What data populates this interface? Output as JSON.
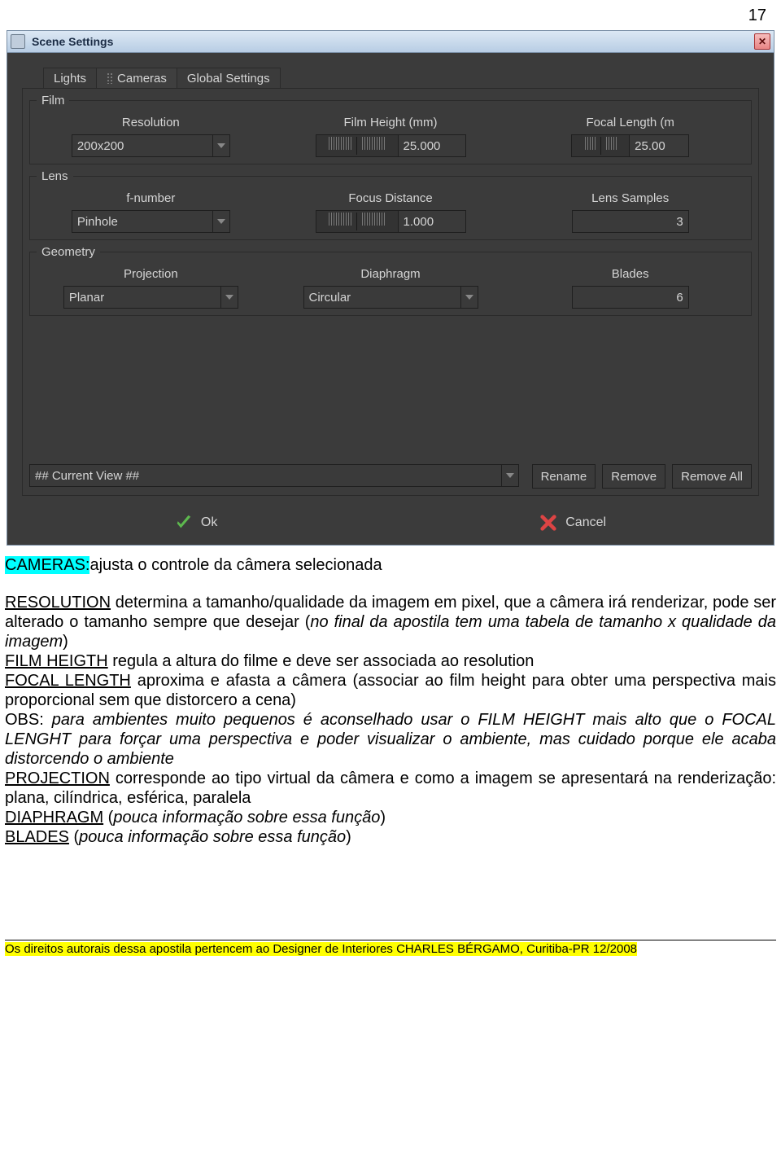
{
  "page_number": "17",
  "window": {
    "title": "Scene Settings"
  },
  "tabs": {
    "t0": "Lights",
    "t1": "Cameras",
    "t2": "Global Settings"
  },
  "film": {
    "legend": "Film",
    "resolution_label": "Resolution",
    "resolution_value": "200x200",
    "height_label": "Film Height (mm)",
    "height_value": "25.000",
    "focal_label": "Focal Length (m",
    "focal_value": "25.00"
  },
  "lens": {
    "legend": "Lens",
    "fnum_label": "f-number",
    "fnum_value": "Pinhole",
    "focus_label": "Focus Distance",
    "focus_value": "1.000",
    "samples_label": "Lens Samples",
    "samples_value": "3"
  },
  "geometry": {
    "legend": "Geometry",
    "proj_label": "Projection",
    "proj_value": "Planar",
    "dia_label": "Diaphragm",
    "dia_value": "Circular",
    "blades_label": "Blades",
    "blades_value": "6"
  },
  "bottom": {
    "view": "## Current View ##",
    "rename": "Rename",
    "remove": "Remove",
    "remove_all": "Remove All",
    "ok": "Ok",
    "cancel": "Cancel"
  },
  "doc": {
    "cameras_label": "CAMERAS:",
    "cameras_rest": "ajusta o controle da câmera selecionada",
    "resolution_label": "RESOLUTION",
    "resolution_text_a": " determina a tamanho/qualidade da imagem em pixel, que a câmera irá renderizar, pode ser alterado o tamanho sempre que desejar (",
    "resolution_text_b": "no final da apostila tem uma tabela de tamanho x qualidade da imagem",
    "resolution_text_c": ")",
    "filmh_label": "FILM HEIGTH",
    "filmh_text": " regula a altura do filme e deve ser associada ao resolution",
    "focal_label": "FOCAL LENGTH",
    "focal_text": " aproxima e afasta a câmera (associar ao film height para obter uma perspectiva mais proporcional sem que distorcero a cena)",
    "obs_a": "OBS: ",
    "obs_b": "para ambientes muito pequenos é aconselhado usar o FILM HEIGHT mais alto que o FOCAL LENGHT para forçar uma perspectiva e poder visualizar o ambiente, mas cuidado porque ele acaba distorcendo o ambiente",
    "proj_label": "PROJECTION",
    "proj_text": " corresponde ao tipo virtual da câmera e como a imagem se apresentará na renderização: plana, cilíndrica, esférica, paralela",
    "dia_label": "DIAPHRAGM",
    "dia_text_a": " (",
    "dia_text_b": "pouca informação sobre essa função",
    "dia_text_c": ")",
    "bl_label": "BLADES",
    "bl_text_a": " (",
    "bl_text_b": "pouca informação sobre essa função",
    "bl_text_c": ")"
  },
  "footer": "Os direitos autorais dessa apostila pertencem ao Designer de Interiores CHARLES BÉRGAMO, Curitiba-PR 12/2008"
}
